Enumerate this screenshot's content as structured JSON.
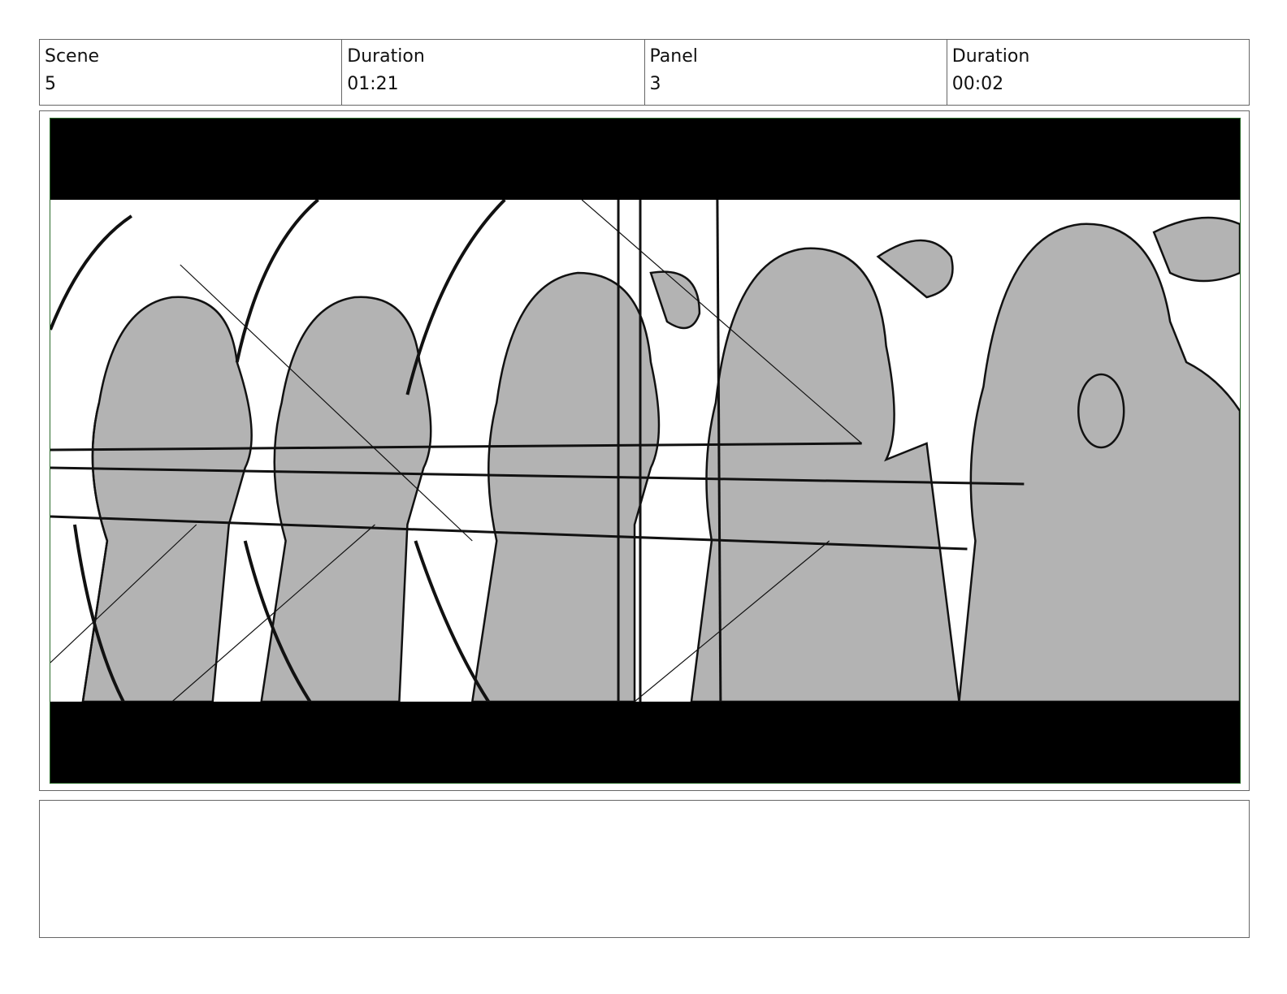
{
  "header": {
    "scene_label": "Scene",
    "scene_value": "5",
    "scene_duration_label": "Duration",
    "scene_duration_value": "01:21",
    "panel_label": "Panel",
    "panel_value": "3",
    "panel_duration_label": "Duration",
    "panel_duration_value": "00:02"
  },
  "panel": {
    "image_description": "sketch-archers-drawing-bows",
    "frame_color": "#2b6a2b",
    "fill_color": "#b3b3b3",
    "line_color": "#111111"
  },
  "notes": {
    "text": ""
  }
}
